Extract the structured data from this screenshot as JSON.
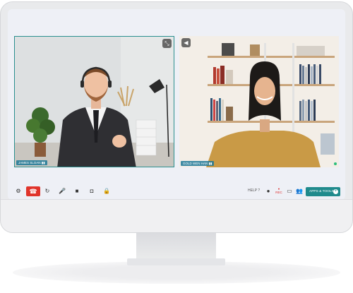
{
  "participants": [
    {
      "name": "JAMES SLOAN",
      "position": "left"
    },
    {
      "name": "GOLD WEN HAN",
      "position": "right"
    }
  ],
  "toolbar": {
    "help_label": "HELP",
    "rec_label": "REC",
    "apps_label": "APPS & TOOLS",
    "icons": [
      "gear-icon",
      "end-call-icon",
      "switch-camera-icon",
      "microphone-icon",
      "video-camera-icon",
      "camera-icon",
      "lock-icon"
    ]
  },
  "colors": {
    "accent": "#1f8a8c",
    "end_call": "#e0342b",
    "active_border": "#2a8f8e"
  }
}
